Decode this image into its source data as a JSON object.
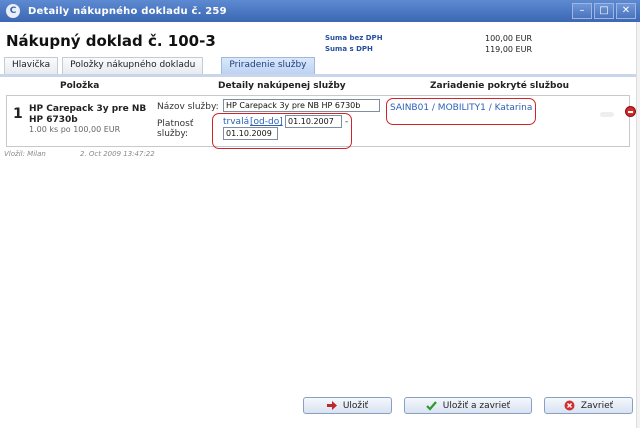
{
  "window": {
    "title": "Detaily nákupného dokladu č. 259",
    "buttons": [
      "–",
      "□",
      "✕"
    ]
  },
  "header": {
    "doc_title": "Nákupný doklad č. 100-3",
    "sum_without_vat_label": "Suma bez DPH",
    "sum_without_vat_value": "100,00 EUR",
    "sum_with_vat_label": "Suma s DPH",
    "sum_with_vat_value": "119,00 EUR"
  },
  "tabs": [
    {
      "label": "Hlavička"
    },
    {
      "label": "Položky nákupného dokladu"
    },
    {
      "label": "Priradenie služby"
    }
  ],
  "table": {
    "col_item": "Položka",
    "col_details": "Detaily nakúpenej služby",
    "col_devices": "Zariadenie pokryté službou"
  },
  "row": {
    "number": "1",
    "item_name": "HP Carepack 3y pre NB HP 6730b",
    "item_qty": "1.00 ks po 100,00 EUR",
    "service_name_label": "Názov služby:",
    "service_name_value": "HP Carepack 3y pre NB HP 6730b",
    "validity_label_1": "Platnosť",
    "validity_label_2": "služby:",
    "validity_permanent": "trvalá",
    "validity_range": "[od-do]",
    "date_from": "01.10.2007",
    "dash": "-",
    "date_to": "01.10.2009",
    "devices_link": "SAINB01 / MOBILITY1 / Katarina"
  },
  "footer": {
    "inserted_by": "Vložil: Milan",
    "inserted_at": "2. Oct 2009 13:47:22"
  },
  "buttons": {
    "save": "Uložiť",
    "save_close": "Uložiť a zavrieť",
    "close": "Zavrieť"
  },
  "colors": {
    "titlebar": "#3b67b4",
    "link": "#2a62b8",
    "highlight": "#d0242a"
  }
}
